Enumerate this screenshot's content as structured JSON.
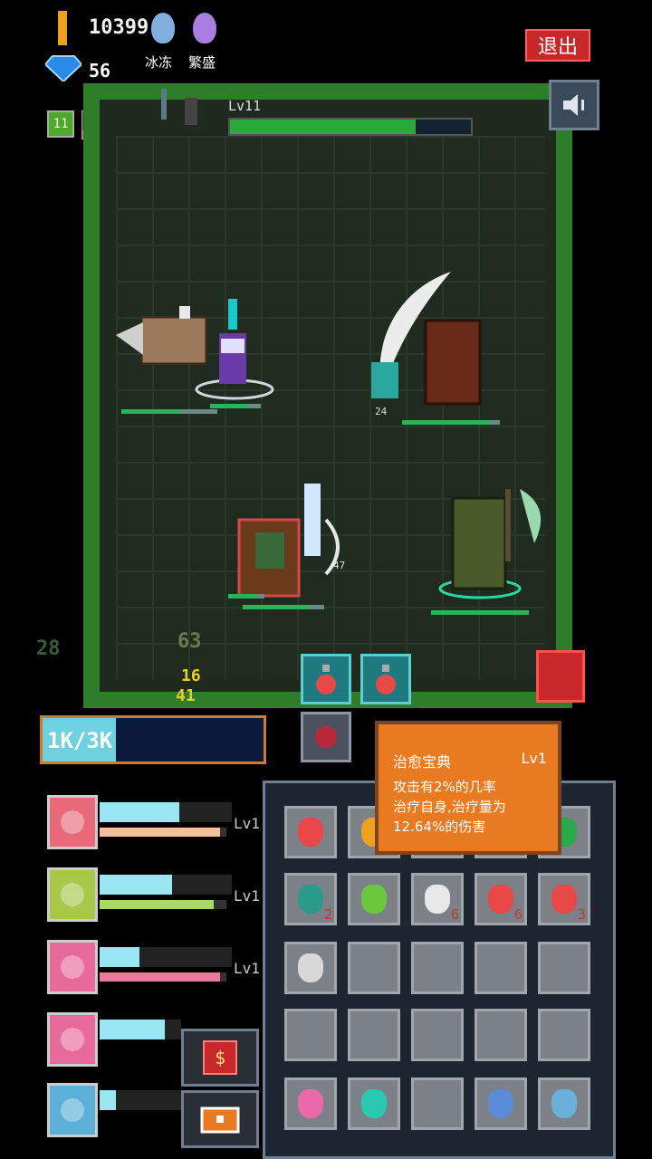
{
  "hud": {
    "gold": "10399",
    "gems": "56",
    "energy": "11",
    "buffs": [
      {
        "label": "冰冻",
        "color": "#7fb0e0"
      },
      {
        "label": "繁盛",
        "color": "#a87ee0"
      }
    ],
    "exit_label": "退出"
  },
  "wave": {
    "level_label": "Lv11",
    "progress": 0.77
  },
  "arena": {
    "units": [
      {
        "kind": "boar",
        "side": "left",
        "hp": 0.6
      },
      {
        "kind": "wizard-hero",
        "side": "left",
        "hp": 0.75
      },
      {
        "kind": "brown-brute",
        "side": "right",
        "hp": 0.9,
        "damage": "24"
      },
      {
        "kind": "goblin-shield",
        "side": "left",
        "hp": 0.8,
        "damage": "47"
      },
      {
        "kind": "orc-axe",
        "side": "right",
        "hp": 1.0
      }
    ],
    "floating_numbers": [
      "28",
      "63",
      "16",
      "41"
    ]
  },
  "mana": {
    "text": "1K/3K",
    "fraction": 0.33
  },
  "heroes": [
    {
      "icon": "red-gem",
      "color": "#e86a7a",
      "top": 0.6,
      "bottom": 0.95,
      "bar_color": "#f0c0a0",
      "level": "Lv1"
    },
    {
      "icon": "bow",
      "color": "#a8c84a",
      "top": 0.55,
      "bottom": 0.9,
      "bar_color": "#a8d86a",
      "level": "Lv1"
    },
    {
      "icon": "wand",
      "color": "#e86a9a",
      "top": 0.3,
      "bottom": 0.95,
      "bar_color": "#e87a9a",
      "level": "Lv1"
    },
    {
      "icon": "spear",
      "color": "#e86a9a",
      "top": 0.8,
      "bottom": 0.0,
      "bar_color": "#9ae6f2",
      "level": ""
    },
    {
      "icon": "crossbow",
      "color": "#5ab0d8",
      "top": 0.2,
      "bottom": 0.0,
      "bar_color": "#9ae6f2",
      "level": ""
    }
  ],
  "inventory": {
    "rows": [
      [
        {
          "icon": "red-potion",
          "count": ""
        },
        {
          "icon": "orange-orb",
          "count": ""
        },
        {
          "icon": "",
          "count": ""
        },
        {
          "icon": "",
          "count": ""
        },
        {
          "icon": "green-book",
          "count": ""
        }
      ],
      [
        {
          "icon": "teal-potion",
          "count": "2"
        },
        {
          "icon": "green-jar",
          "count": ""
        },
        {
          "icon": "white-potion",
          "count": "6"
        },
        {
          "icon": "red-potion",
          "count": "6"
        },
        {
          "icon": "red-potion",
          "count": "3"
        }
      ],
      [
        {
          "icon": "bow",
          "count": ""
        },
        {
          "icon": "",
          "count": ""
        },
        {
          "icon": "",
          "count": ""
        },
        {
          "icon": "",
          "count": ""
        },
        {
          "icon": "",
          "count": ""
        }
      ],
      [
        {
          "icon": "",
          "count": ""
        },
        {
          "icon": "",
          "count": ""
        },
        {
          "icon": "",
          "count": ""
        },
        {
          "icon": "",
          "count": ""
        },
        {
          "icon": "",
          "count": ""
        }
      ],
      [
        {
          "icon": "pink-book",
          "count": ""
        },
        {
          "icon": "teal-book",
          "count": ""
        },
        {
          "icon": "",
          "count": ""
        },
        {
          "icon": "hammer",
          "count": ""
        },
        {
          "icon": "sword",
          "count": ""
        }
      ]
    ]
  },
  "tooltip": {
    "title": "治愈宝典",
    "level": "Lv1",
    "lines": [
      "攻击有2%的几率",
      "治疗自身,治疗量为",
      "12.64%的伤害"
    ]
  },
  "colors": {
    "accent": "#e87a22",
    "hp": "#2ab45a",
    "mana": "#6fd0e0"
  }
}
